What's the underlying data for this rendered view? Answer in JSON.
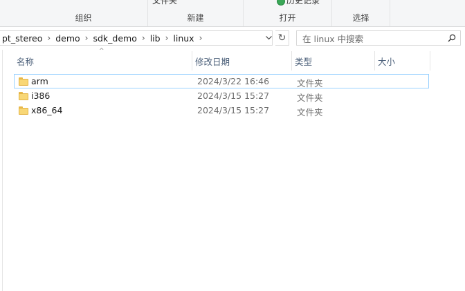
{
  "ribbon": {
    "top_partial_left": "文件夹",
    "top_partial_right": "历史记录",
    "groups": [
      {
        "label": "组织"
      },
      {
        "label": "新建"
      },
      {
        "label": "打开"
      },
      {
        "label": "选择"
      }
    ]
  },
  "address": {
    "crumbs": [
      "pt_stereo",
      "demo",
      "sdk_demo",
      "lib",
      "linux"
    ],
    "separator": "›",
    "dropdown_glyph": "⌄",
    "refresh_glyph": "↻"
  },
  "search": {
    "placeholder": "在 linux 中搜索",
    "icon": "search-icon"
  },
  "columns": {
    "name": "名称",
    "date": "修改日期",
    "type": "类型",
    "size": "大小",
    "sort_indicator": "^"
  },
  "files": [
    {
      "name": "arm",
      "date": "2024/3/22 16:46",
      "type": "文件夹",
      "icon": "folder-icon"
    },
    {
      "name": "i386",
      "date": "2024/3/15 15:27",
      "type": "文件夹",
      "icon": "folder-icon"
    },
    {
      "name": "x86_64",
      "date": "2024/3/15 15:27",
      "type": "文件夹",
      "icon": "folder-icon"
    }
  ],
  "colors": {
    "focus_border": "#99d1ff",
    "header_text": "#4c607a",
    "folder_fill": "#f8d776"
  }
}
